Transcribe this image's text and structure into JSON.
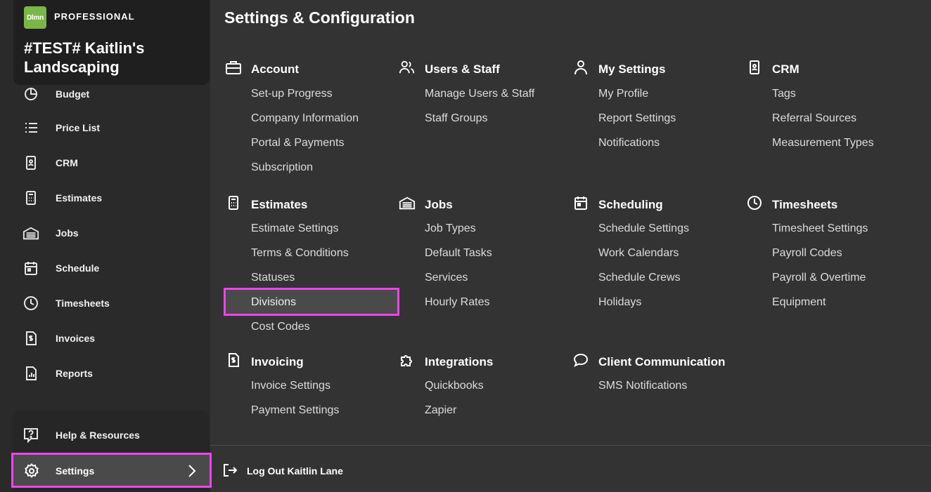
{
  "brand": {
    "logo_text": "Dlmn",
    "tier": "PROFESSIONAL",
    "company": "#TEST# Kaitlin's Landscaping",
    "stripe_colors": [
      "#7ab648",
      "#e8a21a",
      "#2a7ab8"
    ]
  },
  "sidebar": {
    "items": [
      {
        "label": "Budget",
        "icon": "budget-icon"
      },
      {
        "label": "Price List",
        "icon": "list-icon"
      },
      {
        "label": "CRM",
        "icon": "contact-card-icon"
      },
      {
        "label": "Estimates",
        "icon": "calculator-icon"
      },
      {
        "label": "Jobs",
        "icon": "garage-icon"
      },
      {
        "label": "Schedule",
        "icon": "calendar-icon"
      },
      {
        "label": "Timesheets",
        "icon": "clock-icon"
      },
      {
        "label": "Invoices",
        "icon": "invoice-icon"
      },
      {
        "label": "Reports",
        "icon": "report-icon"
      }
    ],
    "help_label": "Help & Resources",
    "settings_label": "Settings"
  },
  "main": {
    "title": "Settings & Configuration",
    "sections": [
      {
        "title": "Account",
        "icon": "briefcase-icon",
        "links": [
          "Set-up Progress",
          "Company Information",
          "Portal & Payments",
          "Subscription"
        ]
      },
      {
        "title": "Users & Staff",
        "icon": "users-icon",
        "links": [
          "Manage Users & Staff",
          "Staff Groups"
        ]
      },
      {
        "title": "My Settings",
        "icon": "user-icon",
        "links": [
          "My Profile",
          "Report Settings",
          "Notifications"
        ]
      },
      {
        "title": "CRM",
        "icon": "contact-card-icon",
        "links": [
          "Tags",
          "Referral Sources",
          "Measurement Types"
        ]
      },
      {
        "title": "Estimates",
        "icon": "calculator-icon",
        "links": [
          "Estimate Settings",
          "Terms & Conditions",
          "Statuses",
          "Divisions",
          "Cost Codes"
        ]
      },
      {
        "title": "Jobs",
        "icon": "garage-icon",
        "links": [
          "Job Types",
          "Default Tasks",
          "Services",
          "Hourly Rates"
        ]
      },
      {
        "title": "Scheduling",
        "icon": "calendar-icon",
        "links": [
          "Schedule Settings",
          "Work Calendars",
          "Schedule Crews",
          "Holidays"
        ]
      },
      {
        "title": "Timesheets",
        "icon": "clock-icon",
        "links": [
          "Timesheet Settings",
          "Payroll Codes",
          "Payroll & Overtime",
          "Equipment"
        ]
      },
      {
        "title": "Invoicing",
        "icon": "invoice-icon",
        "links": [
          "Invoice Settings",
          "Payment Settings"
        ]
      },
      {
        "title": "Integrations",
        "icon": "puzzle-icon",
        "links": [
          "Quickbooks",
          "Zapier"
        ]
      },
      {
        "title": "Client Communication",
        "icon": "chat-bubble-icon",
        "links": [
          "SMS Notifications"
        ]
      }
    ],
    "logout_label": "Log Out Kaitlin Lane"
  }
}
